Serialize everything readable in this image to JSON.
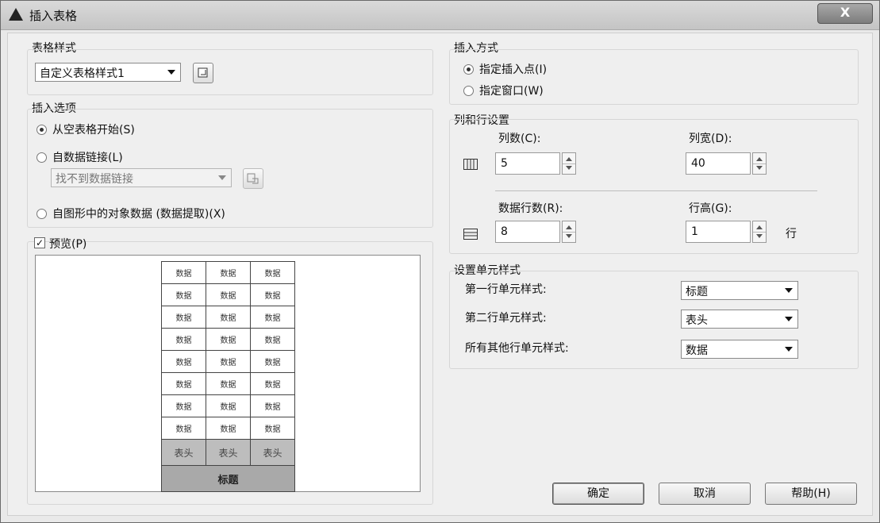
{
  "window": {
    "title": "插入表格",
    "close_label": "X"
  },
  "table_style": {
    "group_label": "表格样式",
    "selected": "自定义表格样式1"
  },
  "insert_options": {
    "group_label": "插入选项",
    "opt_empty": "从空表格开始(S)",
    "opt_datalink": "自数据链接(L)",
    "datalink_combo": "找不到数据链接",
    "opt_extract": "自图形中的对象数据 (数据提取)(X)",
    "selected": "opt_empty"
  },
  "preview": {
    "label": "预览(P)",
    "checked": true,
    "data_cell": "数据",
    "header_cells": [
      "表头",
      "表头",
      "表头"
    ],
    "title_cell": "标题"
  },
  "insert_method": {
    "group_label": "插入方式",
    "opt_point": "指定插入点(I)",
    "opt_window": "指定窗口(W)",
    "selected": "opt_point"
  },
  "rowcol": {
    "group_label": "列和行设置",
    "columns_label": "列数(C):",
    "columns_value": "5",
    "colwidth_label": "列宽(D):",
    "colwidth_value": "40",
    "datarows_label": "数据行数(R):",
    "datarows_value": "8",
    "rowheight_label": "行高(G):",
    "rowheight_value": "1",
    "rowheight_unit": "行"
  },
  "cell_styles": {
    "group_label": "设置单元样式",
    "first_row_label": "第一行单元样式:",
    "first_row_value": "标题",
    "second_row_label": "第二行单元样式:",
    "second_row_value": "表头",
    "other_rows_label": "所有其他行单元样式:",
    "other_rows_value": "数据"
  },
  "buttons": {
    "ok": "确定",
    "cancel": "取消",
    "help": "帮助(H)"
  }
}
